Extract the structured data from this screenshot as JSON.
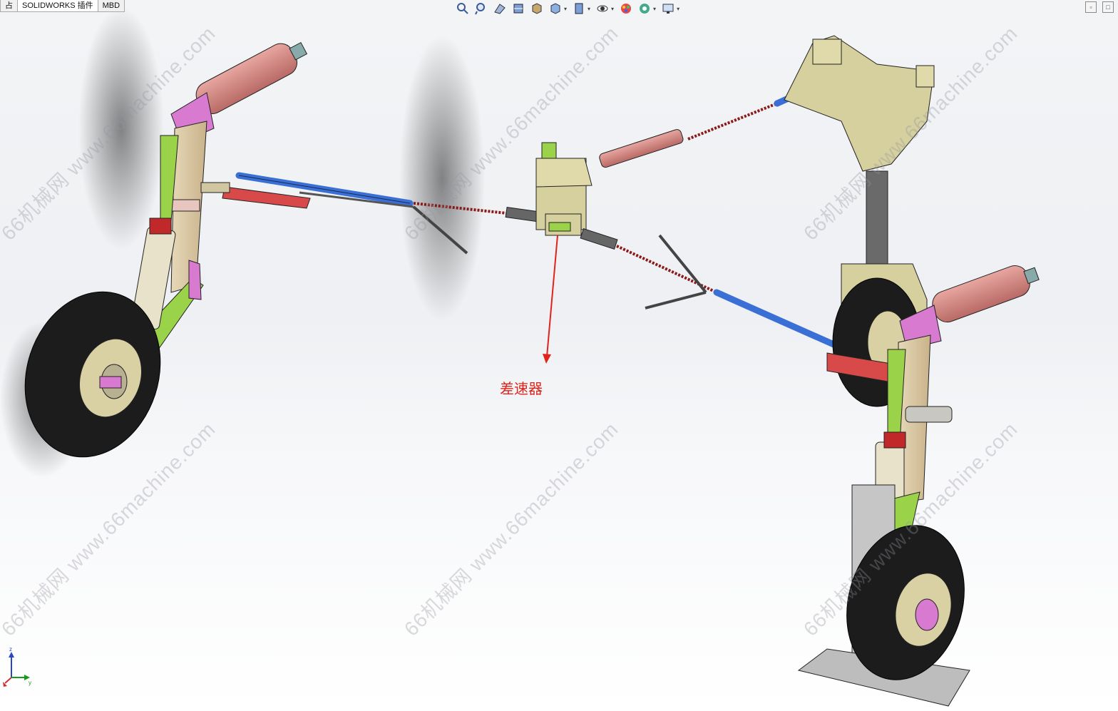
{
  "tabs": [
    {
      "label": "占"
    },
    {
      "label": "SOLIDWORKS 插件"
    },
    {
      "label": "MBD"
    }
  ],
  "view_toolbar": {
    "icons": [
      "zoom-to-fit-icon",
      "zoom-to-area-icon",
      "previous-view-icon",
      "section-view-icon",
      "view-orientation-icon",
      "display-style-icon",
      "hide-show-icon",
      "edit-appearance-icon",
      "apply-scene-icon",
      "view-settings-icon",
      "display-monitor-icon"
    ]
  },
  "annotation": {
    "callout_label": "差速器",
    "color": "#e0241b"
  },
  "watermark": {
    "text": "66机械网 www.66machine.com",
    "color": "#9696a0"
  },
  "triad": {
    "x_label": "x",
    "y_label": "y",
    "z_label": "z"
  },
  "colors": {
    "tire": "#1c1c1c",
    "strut_green": "#9ad24a",
    "actuator_pink": "#d98a86",
    "rod_blue": "#3a6fd6",
    "housing_beige": "#d6cf9e",
    "brace_red": "#d84a4a"
  }
}
